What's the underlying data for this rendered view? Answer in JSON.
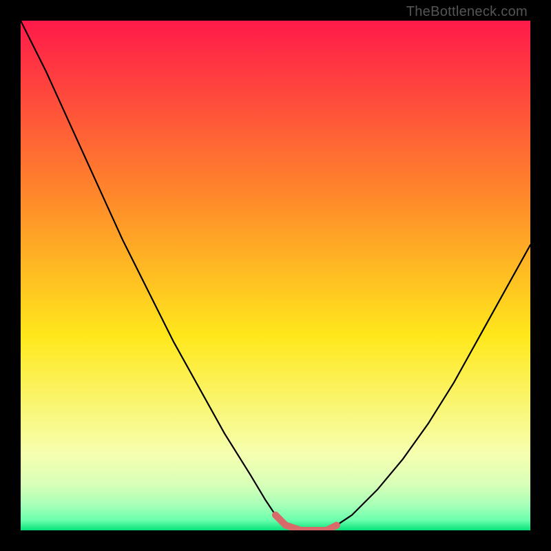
{
  "watermark": "TheBottleneck.com",
  "chart_data": {
    "type": "line",
    "title": "",
    "xlabel": "",
    "ylabel": "",
    "xlim": [
      0,
      100
    ],
    "ylim": [
      0,
      100
    ],
    "x": [
      0,
      5,
      10,
      15,
      20,
      25,
      30,
      35,
      40,
      45,
      48,
      50,
      52,
      55,
      58,
      60,
      62,
      65,
      70,
      75,
      80,
      85,
      90,
      95,
      100
    ],
    "values": [
      100,
      90,
      79,
      68,
      57,
      47,
      37,
      28,
      19,
      11,
      6,
      3,
      1,
      0,
      0,
      0,
      1,
      3,
      8,
      14,
      21,
      29,
      38,
      47,
      56
    ],
    "highlight_segment": {
      "x": [
        50,
        52,
        55,
        58,
        60,
        62
      ],
      "values": [
        3,
        1,
        0,
        0,
        0,
        1
      ]
    },
    "gradient_colors": {
      "top": "#ff1a4a",
      "upper_mid": "#ff8a2a",
      "mid": "#ffe81c",
      "lower_mid": "#f6ffb0",
      "band1": "#d8ffb8",
      "band2": "#a8ffb8",
      "band3": "#6affad",
      "bottom": "#08e27a"
    },
    "highlight_color": "#d96a6a",
    "curve_color": "#000000"
  }
}
